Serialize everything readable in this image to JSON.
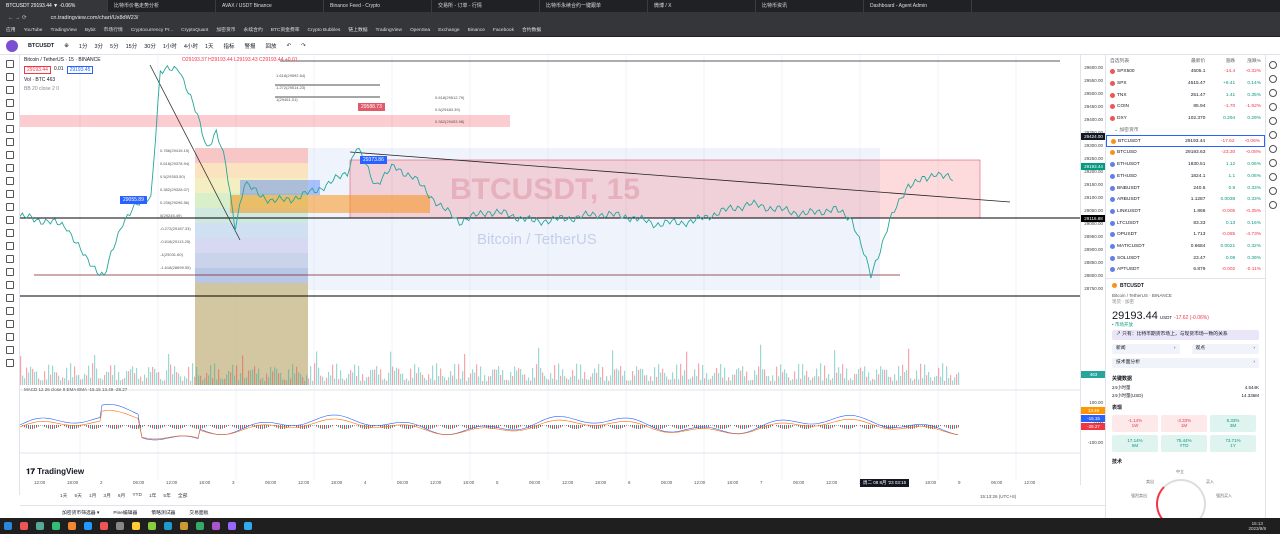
{
  "browser": {
    "tabs": [
      "BTCUSDT 29193.44 ▼ -0.06%",
      "比特币价格走势分析",
      "AVAX / USDT Binance",
      "Binance Feed - Crypto",
      "交易所 - 订单 - 行情",
      "比特币永续合约一键跟单",
      "微博 / X",
      "比特币资讯",
      "Dashboard - Agent Admin"
    ],
    "url": "cn.tradingview.com/chart/Ux8dW23/",
    "bookmarks": [
      "应用",
      "YouTube",
      "TradingView",
      "Bybit",
      "市场行情",
      "Cryptocurrency Pr...",
      "CryptoQuant",
      "加密货币",
      "永续合约",
      "BTC资金费率",
      "Crypto Bubbles",
      "链上数据",
      "TradingView",
      "OpenSea",
      "Exchange",
      "Binance",
      "Facebook",
      "合约数据"
    ]
  },
  "toolbar": {
    "symbol": "BTCUSDT",
    "intervals": [
      "1分",
      "3分",
      "5分",
      "15分",
      "30分",
      "1小时",
      "4小时",
      "1天"
    ],
    "indicators": "指标",
    "alert": "警报",
    "replay": "回放",
    "undo": "↶",
    "redo": "↷"
  },
  "legend": {
    "title": "Bitcoin / TetherUS · 15 · BINANCE",
    "ohlc": "O29193.37 H29193.44 L29193.43 C29193.44 +0.01",
    "sell": "29193.44",
    "spread": "0.01",
    "buy": "29193.45",
    "vol": "Vol · BTC 463",
    "bb": "BB 20 close 2 0"
  },
  "chart": {
    "watermark": "BTCUSDT, 15",
    "watermark_sub": "Bitcoin / TetherUS",
    "price_tags": {
      "top": "29588.73",
      "mid": "29373.86",
      "left": "29055.89"
    },
    "fib_labels": [
      "1.618(29592.64)",
      "1.272(29514.23)",
      "1(29461.01)",
      "0.786(29415.15)",
      "0.618(29378.94)",
      "0.5(29353.50)",
      "0.382(29328.07)",
      "0.236(29296.56)",
      "0(29245.49)",
      "-0.272(29187.33)",
      "-0.618(29113.25)",
      "-1(29031.60)",
      "-1.618(28899.55)"
    ],
    "proj_labels": [
      "0.618(29512.79)",
      "0.5(29483.39)",
      "0.382(29453.98)"
    ],
    "macd_label": "MACD 12 26 close 9 EMA EMA  -15.15  13.49  -28.27",
    "tv_logo": "TradingView",
    "price_range": [
      28700,
      29650
    ],
    "price_series": [
      [
        0,
        29020
      ],
      [
        3,
        29000
      ],
      [
        5,
        28980
      ],
      [
        7,
        28850
      ],
      [
        9,
        28780
      ],
      [
        11,
        29000
      ],
      [
        12,
        29050
      ],
      [
        14,
        29100
      ],
      [
        15,
        29600
      ],
      [
        17,
        29620
      ],
      [
        19,
        29420
      ],
      [
        20,
        29300
      ],
      [
        21,
        29360
      ],
      [
        22,
        29230
      ],
      [
        23,
        28980
      ],
      [
        24,
        29150
      ],
      [
        27,
        29080
      ],
      [
        30,
        29100
      ],
      [
        33,
        29150
      ],
      [
        35,
        29200
      ],
      [
        36,
        29300
      ],
      [
        38,
        29150
      ],
      [
        40,
        29220
      ],
      [
        42,
        29180
      ],
      [
        45,
        29060
      ],
      [
        47,
        29000
      ],
      [
        50,
        29040
      ],
      [
        52,
        29030
      ],
      [
        55,
        29000
      ],
      [
        58,
        29010
      ],
      [
        62,
        29030
      ],
      [
        65,
        29020
      ],
      [
        68,
        28990
      ],
      [
        72,
        29000
      ],
      [
        75,
        29040
      ],
      [
        78,
        29070
      ],
      [
        81,
        29050
      ],
      [
        84,
        29030
      ],
      [
        87,
        29050
      ],
      [
        89,
        29010
      ],
      [
        90,
        28900
      ],
      [
        91,
        28780
      ],
      [
        93,
        29000
      ],
      [
        95,
        29150
      ],
      [
        97,
        29170
      ],
      [
        98,
        29200
      ],
      [
        100,
        29160
      ]
    ]
  },
  "axis": {
    "prices": [
      "29600.00",
      "29550.00",
      "29500.00",
      "29450.00",
      "29400.00",
      "29350.00",
      "29300.00",
      "29250.00",
      "29200.00",
      "29150.00",
      "29100.00",
      "29050.00",
      "29000.00",
      "28950.00",
      "28900.00",
      "28850.00",
      "28800.00",
      "28750.00"
    ],
    "current": "29193.44",
    "countdown": "08:56",
    "black_tag": "29116.88",
    "cross_tag": "29424.00",
    "vol_tag": "463",
    "macd_tags": [
      "13.49",
      "-15.15",
      "-28.27"
    ],
    "macd_scale": [
      "100.00",
      "0.00",
      "-100.00"
    ]
  },
  "time_axis": {
    "labels": [
      "12:00",
      "18:00",
      "2",
      "06:00",
      "12:00",
      "18:00",
      "3",
      "06:00",
      "12:00",
      "18:00",
      "4",
      "06:00",
      "12:00",
      "18:00",
      "5",
      "06:00",
      "12:00",
      "18:00",
      "6",
      "06:00",
      "12:00",
      "18:00",
      "7",
      "06:00",
      "12:00",
      "18:00",
      "12:00",
      "18:00",
      "9",
      "06:00",
      "12:00"
    ],
    "cursor": "周二 08 8月 '23 03:15",
    "timezone": "15:13:26 (UTC+8)"
  },
  "timeframes": [
    "1天",
    "5天",
    "1月",
    "3月",
    "6月",
    "YTD",
    "1年",
    "5年",
    "全部"
  ],
  "bottom_tabs": [
    "加密货币筛选器 ▾",
    "Pine编辑器",
    "策略测试器",
    "交易面板"
  ],
  "watchlist": {
    "headers": [
      "自选列表",
      "最新价",
      "涨跌",
      "涨跌%"
    ],
    "section": "加密货币",
    "rows_top": [
      {
        "sym": "SPX500",
        "last": "4505.1",
        "chg": "-14.4",
        "pct": "-0.32%",
        "neg": true
      },
      {
        "sym": "SPX",
        "last": "4515.47",
        "chg": "+6.41",
        "pct": "0.14%",
        "neg": false
      },
      {
        "sym": "TNX",
        "last": "251.47",
        "chg": "1.41",
        "pct": "0.35%",
        "neg": false
      },
      {
        "sym": "COIN",
        "last": "85.94",
        "chg": "-1.70",
        "pct": "-1.92%",
        "neg": true
      },
      {
        "sym": "DXY",
        "last": "102.370",
        "chg": "0.294",
        "pct": "0.29%",
        "neg": false
      }
    ],
    "rows": [
      {
        "sym": "BTCUSDT",
        "last": "29193.44",
        "chg": "-17.62",
        "pct": "-0.06%",
        "neg": true
      },
      {
        "sym": "BTCUSD",
        "last": "29193.63",
        "chg": "-23.30",
        "pct": "-0.08%",
        "neg": true
      },
      {
        "sym": "ETHUSDT",
        "last": "1830.51",
        "chg": "1.12",
        "pct": "0.06%",
        "neg": false
      },
      {
        "sym": "ETHUSD",
        "last": "1824.1",
        "chg": "1.1",
        "pct": "0.06%",
        "neg": false
      },
      {
        "sym": "BNBUSDT",
        "last": "240.5",
        "chg": "0.8",
        "pct": "0.33%",
        "neg": false
      },
      {
        "sym": "ARBUSDT",
        "last": "1.1287",
        "chg": "0.0038",
        "pct": "0.33%",
        "neg": false
      },
      {
        "sym": "LINKUSDT",
        "last": "1.866",
        "chg": "-0.005",
        "pct": "-0.35%",
        "neg": true
      },
      {
        "sym": "LTCUSDT",
        "last": "83.33",
        "chg": "0.13",
        "pct": "0.16%",
        "neg": false
      },
      {
        "sym": "OPUSDT",
        "last": "1.713",
        "chg": "-0.085",
        "pct": "-4.73%",
        "neg": true
      },
      {
        "sym": "MATICUSDT",
        "last": "0.6684",
        "chg": "0.0021",
        "pct": "0.32%",
        "neg": false
      },
      {
        "sym": "SOLUSDT",
        "last": "23.47",
        "chg": "0.09",
        "pct": "0.39%",
        "neg": false
      },
      {
        "sym": "APTUSDT",
        "last": "6.879",
        "chg": "-0.002",
        "pct": "-0.11%",
        "neg": true
      }
    ]
  },
  "details": {
    "symbol": "BTCUSDT",
    "name": "Bitcoin / TetherUS · BINANCE",
    "type": "现货 · 加密",
    "price": "29193.44",
    "currency": "USDT",
    "change": "-17.62 (-0.06%)",
    "status": "• 市场开放",
    "banner": "↗ 只有：比特币期货市场上，与现货市场一致的关系",
    "links": [
      "新闻",
      "观点",
      "技术面分析"
    ],
    "key_title": "关键数据",
    "key_rows": [
      [
        "24小时量",
        "4.544K"
      ],
      [
        "24小时量(USD)",
        "14.336M"
      ]
    ],
    "perf_title": "表现",
    "perf": [
      {
        "v": "-1.14%",
        "p": "1W",
        "neg": true
      },
      {
        "v": "-3.33%",
        "p": "1M",
        "neg": true
      },
      {
        "v": "5.33%",
        "p": "3M",
        "neg": false
      },
      {
        "v": "17.14%",
        "p": "6M",
        "neg": false
      },
      {
        "v": "75.44%",
        "p": "YTD",
        "neg": false
      },
      {
        "v": "73.71%",
        "p": "1Y",
        "neg": false
      }
    ],
    "tech_title": "技术",
    "gauge": [
      "强烈卖出",
      "卖出",
      "中立",
      "买入",
      "强烈买入"
    ]
  },
  "taskbar": {
    "time": "15:13",
    "date": "2023/8/8"
  }
}
